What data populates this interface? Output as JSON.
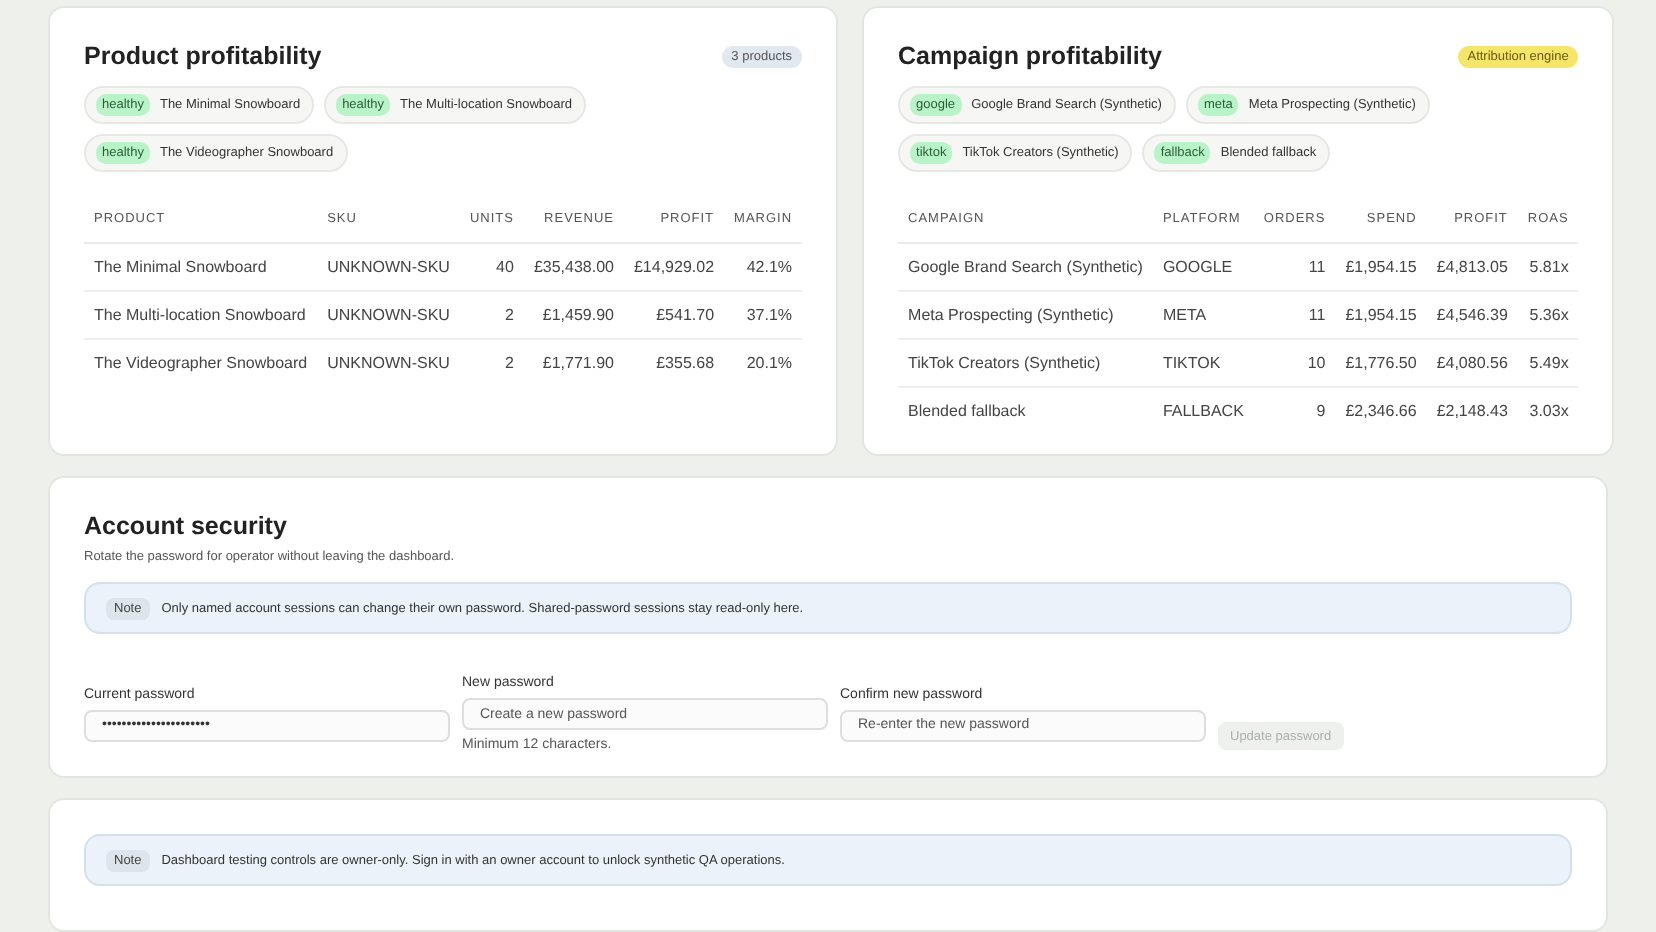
{
  "products": {
    "title": "Product profitability",
    "badge": "3 products",
    "chips": [
      {
        "tag": "healthy",
        "label": "The Minimal Snowboard"
      },
      {
        "tag": "healthy",
        "label": "The Multi-location Snowboard"
      },
      {
        "tag": "healthy",
        "label": "The Videographer Snowboard"
      }
    ],
    "columns": [
      "PRODUCT",
      "SKU",
      "UNITS",
      "REVENUE",
      "PROFIT",
      "MARGIN"
    ],
    "rows": [
      [
        "The Minimal Snowboard",
        "UNKNOWN-SKU",
        "40",
        "£35,438.00",
        "£14,929.02",
        "42.1%"
      ],
      [
        "The Multi-location Snowboard",
        "UNKNOWN-SKU",
        "2",
        "£1,459.90",
        "£541.70",
        "37.1%"
      ],
      [
        "The Videographer Snowboard",
        "UNKNOWN-SKU",
        "2",
        "£1,771.90",
        "£355.68",
        "20.1%"
      ]
    ]
  },
  "campaigns": {
    "title": "Campaign profitability",
    "badge": "Attribution engine",
    "chips": [
      {
        "tag": "google",
        "label": "Google Brand Search (Synthetic)"
      },
      {
        "tag": "meta",
        "label": "Meta Prospecting (Synthetic)"
      },
      {
        "tag": "tiktok",
        "label": "TikTok Creators (Synthetic)"
      },
      {
        "tag": "fallback",
        "label": "Blended fallback"
      }
    ],
    "columns": [
      "CAMPAIGN",
      "PLATFORM",
      "ORDERS",
      "SPEND",
      "PROFIT",
      "ROAS"
    ],
    "rows": [
      [
        "Google Brand Search (Synthetic)",
        "GOOGLE",
        "11",
        "£1,954.15",
        "£4,813.05",
        "5.81x"
      ],
      [
        "Meta Prospecting (Synthetic)",
        "META",
        "11",
        "£1,954.15",
        "£4,546.39",
        "5.36x"
      ],
      [
        "TikTok Creators (Synthetic)",
        "TIKTOK",
        "10",
        "£1,776.50",
        "£4,080.56",
        "5.49x"
      ],
      [
        "Blended fallback",
        "FALLBACK",
        "9",
        "£2,346.66",
        "£2,148.43",
        "3.03x"
      ]
    ]
  },
  "security": {
    "title": "Account security",
    "subtitle": "Rotate the password for operator without leaving the dashboard.",
    "note": {
      "tag": "Note",
      "text": "Only named account sessions can change their own password. Shared-password sessions stay read-only here."
    },
    "fields": [
      {
        "label": "Current password",
        "value": "••••••••••••••••••••••"
      },
      {
        "label": "New password",
        "placeholder": "Create a new password",
        "hint": "Minimum 12 characters."
      },
      {
        "label": "Confirm new password",
        "placeholder": "Re-enter the new password"
      }
    ],
    "button": {
      "label": "Update password",
      "disabled": true
    }
  },
  "testing": {
    "note": {
      "tag": "Note",
      "text": "Dashboard testing controls are owner-only. Sign in with an owner account to unlock synthetic QA operations."
    }
  }
}
